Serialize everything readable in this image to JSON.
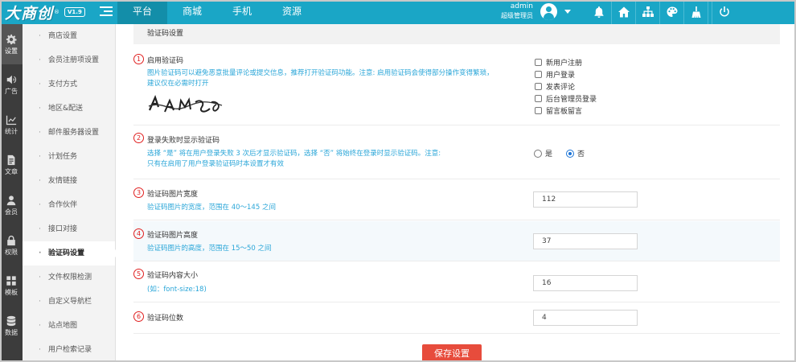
{
  "header": {
    "logo": "大商创",
    "logo_mark": "®",
    "version": "V1.9",
    "nav": [
      "平台",
      "商城",
      "手机",
      "资源"
    ],
    "admin_name": "admin",
    "admin_role": "超级管理员",
    "icons": [
      "bell-icon",
      "home-icon",
      "sitemap-icon",
      "palette-icon",
      "broom-icon",
      "power-icon"
    ],
    "accent_color": "#1aa6c6"
  },
  "iconbar": [
    {
      "label": "设置",
      "icon": "gear-icon"
    },
    {
      "label": "广告",
      "icon": "speaker-icon"
    },
    {
      "label": "统计",
      "icon": "chart-icon"
    },
    {
      "label": "文章",
      "icon": "document-icon"
    },
    {
      "label": "会员",
      "icon": "user-icon"
    },
    {
      "label": "权限",
      "icon": "lock-icon"
    },
    {
      "label": "模板",
      "icon": "grid-icon"
    },
    {
      "label": "数据",
      "icon": "database-icon"
    }
  ],
  "submenu": [
    "商店设置",
    "会员注册项设置",
    "支付方式",
    "地区&配送",
    "邮件服务器设置",
    "计划任务",
    "友情链接",
    "合作伙伴",
    "接口对接",
    "验证码设置",
    "文件权限检测",
    "自定义导航栏",
    "站点地图",
    "用户检索记录"
  ],
  "section_title": "验证码设置",
  "rows": [
    {
      "num": "1",
      "title": "启用验证码",
      "desc1": "图片验证码可以避免恶意批量评论或提交信息，推荐打开验证码功能。注意: 启用验证码会使得部分操作变得繁琐，",
      "desc2": "建议仅在必需时打开",
      "options": [
        "新用户注册",
        "用户登录",
        "发表评论",
        "后台管理员登录",
        "留言板留言"
      ]
    },
    {
      "num": "2",
      "title": "登录失败时显示验证码",
      "desc1": "选择 “是” 将在用户登录失败 3 次后才显示验证码，选择 “否” 将始终在登录时显示验证码。注意:",
      "desc2": "只有在启用了用户登录验证码时本设置才有效",
      "radio_yes": "是",
      "radio_no": "否"
    },
    {
      "num": "3",
      "title": "验证码图片宽度",
      "desc1": "验证码图片的宽度，范围在 40～145 之间",
      "value": "112"
    },
    {
      "num": "4",
      "title": "验证码图片高度",
      "desc1": "验证码图片的高度，范围在 15～50 之间",
      "value": "37"
    },
    {
      "num": "5",
      "title": "验证码内容大小",
      "desc1": "(如：font-size:18)",
      "value": "16"
    },
    {
      "num": "6",
      "title": "验证码位数",
      "value": "4"
    }
  ],
  "save_label": "保存设置"
}
